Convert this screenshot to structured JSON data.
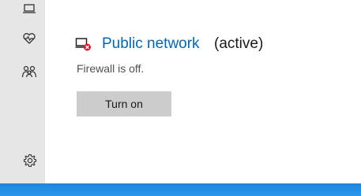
{
  "sidebar": {
    "items": [
      {
        "icon": "laptop-icon"
      },
      {
        "icon": "heart-pulse-icon"
      },
      {
        "icon": "family-icon"
      },
      {
        "icon": "gear-icon"
      }
    ]
  },
  "network": {
    "icon": "public-network-off-icon",
    "title": "Public network",
    "status": "(active)",
    "firewall_text": "Firewall is off.",
    "turn_on_label": "Turn on"
  },
  "colors": {
    "sidebar_bg": "#e6e6e6",
    "link": "#0067b8",
    "button_bg": "#cccccc",
    "error_badge": "#e81123",
    "desktop": "#1f8ae0"
  }
}
